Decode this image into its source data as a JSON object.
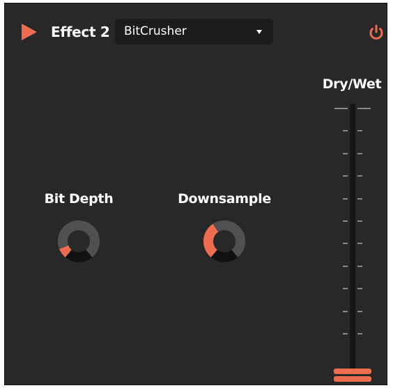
{
  "effect": {
    "label": "Effect 2",
    "selected_type": "BitCrusher",
    "enabled": true
  },
  "knobs": [
    {
      "id": "bit-depth",
      "label": "Bit Depth",
      "value": 0.1
    },
    {
      "id": "downsample",
      "label": "Downsample",
      "value": 0.38
    }
  ],
  "dry_wet": {
    "label": "Dry/Wet",
    "value": 0.0
  },
  "icons": {
    "play": "play-icon",
    "dropdown": "chevron-down-icon",
    "power": "power-icon"
  },
  "colors": {
    "accent": "#ee6d4f",
    "panel": "#282828",
    "knob_track": "#505050",
    "knob_gap": "#111111",
    "dropdown_bg": "#1c1c1c"
  }
}
